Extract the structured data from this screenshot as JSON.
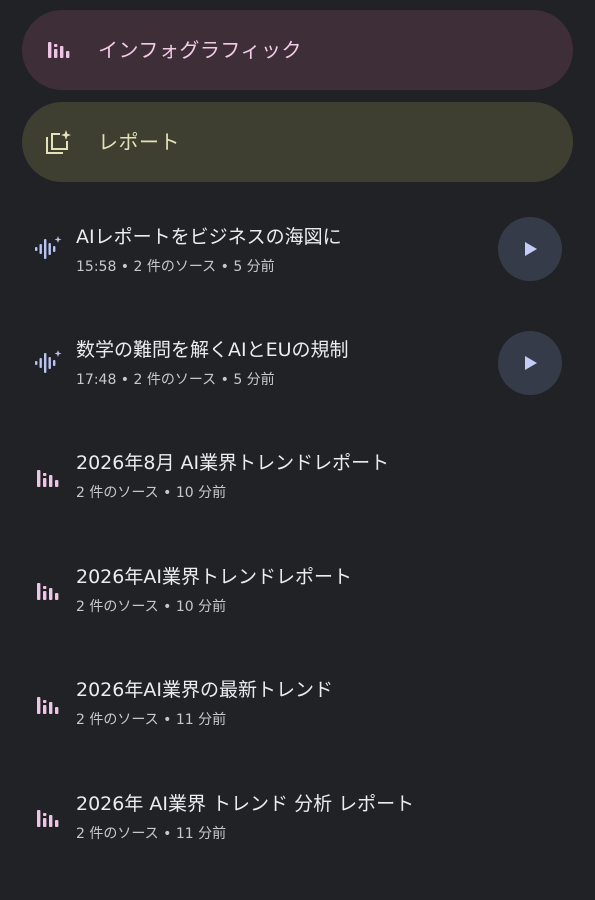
{
  "actions": [
    {
      "label": "インフォグラフィック",
      "icon": "bar-chart-icon",
      "color": "#f2c9e6",
      "background": "#3d2e38"
    },
    {
      "label": "レポート",
      "icon": "report-sparkle-icon",
      "color": "#e6e2b8",
      "background": "#3f3f31"
    }
  ],
  "items": [
    {
      "title": "AIレポートをビジネスの海図に",
      "meta": "15:58 • 2 件のソース • 5 分前",
      "icon": "audio-wave-icon",
      "has_play": true
    },
    {
      "title": "数学の難問を解くAIとEUの規制",
      "meta": "17:48 • 2 件のソース • 5 分前",
      "icon": "audio-wave-icon",
      "has_play": true
    },
    {
      "title": "2026年8月 AI業界トレンドレポート",
      "meta": "2 件のソース • 10 分前",
      "icon": "bar-chart-icon",
      "has_play": false
    },
    {
      "title": "2026年AI業界トレンドレポート",
      "meta": "2 件のソース • 10 分前",
      "icon": "bar-chart-icon",
      "has_play": false
    },
    {
      "title": "2026年AI業界の最新トレンド",
      "meta": "2 件のソース • 11 分前",
      "icon": "bar-chart-icon",
      "has_play": false
    },
    {
      "title": "2026年 AI業界 トレンド 分析 レポート",
      "meta": "2 件のソース • 11 分前",
      "icon": "bar-chart-icon",
      "has_play": false
    }
  ],
  "colors": {
    "background": "#202226",
    "icon_pink": "#f0c4e6",
    "icon_blue": "#b9c3f5",
    "play_bg": "#363b4a",
    "play_glyph": "#c5cdf7"
  }
}
